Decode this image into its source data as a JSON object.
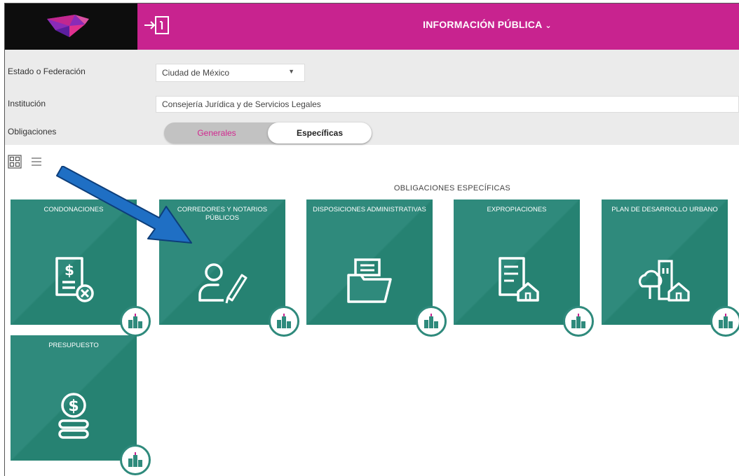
{
  "header": {
    "title": "INFORMACIÓN PÚBLICA",
    "dropdown_icon": "chevron-down-icon",
    "exit_icon": "exit-info-icon",
    "colors": {
      "accent": "#c8238f",
      "logo_bg": "#0d0d0d"
    }
  },
  "filters": {
    "estado": {
      "label": "Estado o Federación",
      "value": "Ciudad de México"
    },
    "institucion": {
      "label": "Institución",
      "value": "Consejería Jurídica y de Servicios Legales"
    },
    "obligaciones": {
      "label": "Obligaciones",
      "option_general": "Generales",
      "option_specific": "Específicas",
      "selected": "Específicas"
    }
  },
  "view": {
    "grid_icon": "grid-view-icon",
    "list_icon": "list-view-icon"
  },
  "section": {
    "title": "OBLIGACIONES ESPECÍFICAS",
    "tiles": [
      {
        "title": "CONDONACIONES",
        "icon": "document-money-cancel-icon"
      },
      {
        "title": "CORREDORES Y NOTARIOS PÚBLICOS",
        "icon": "person-pen-icon"
      },
      {
        "title": "DISPOSICIONES ADMINISTRATIVAS",
        "icon": "folder-icon"
      },
      {
        "title": "EXPROPIACIONES",
        "icon": "list-house-icon"
      },
      {
        "title": "PLAN DE DESARROLLO URBANO",
        "icon": "tree-building-house-icon"
      },
      {
        "title": "PRESUPUESTO",
        "icon": "coin-stack-icon"
      }
    ],
    "badge_icon": "city-buildings-icon",
    "tile_color": "#2f8a7c"
  },
  "annotation": {
    "arrow_icon": "blue-arrow-icon",
    "arrow_color": "#1f6fc4"
  }
}
